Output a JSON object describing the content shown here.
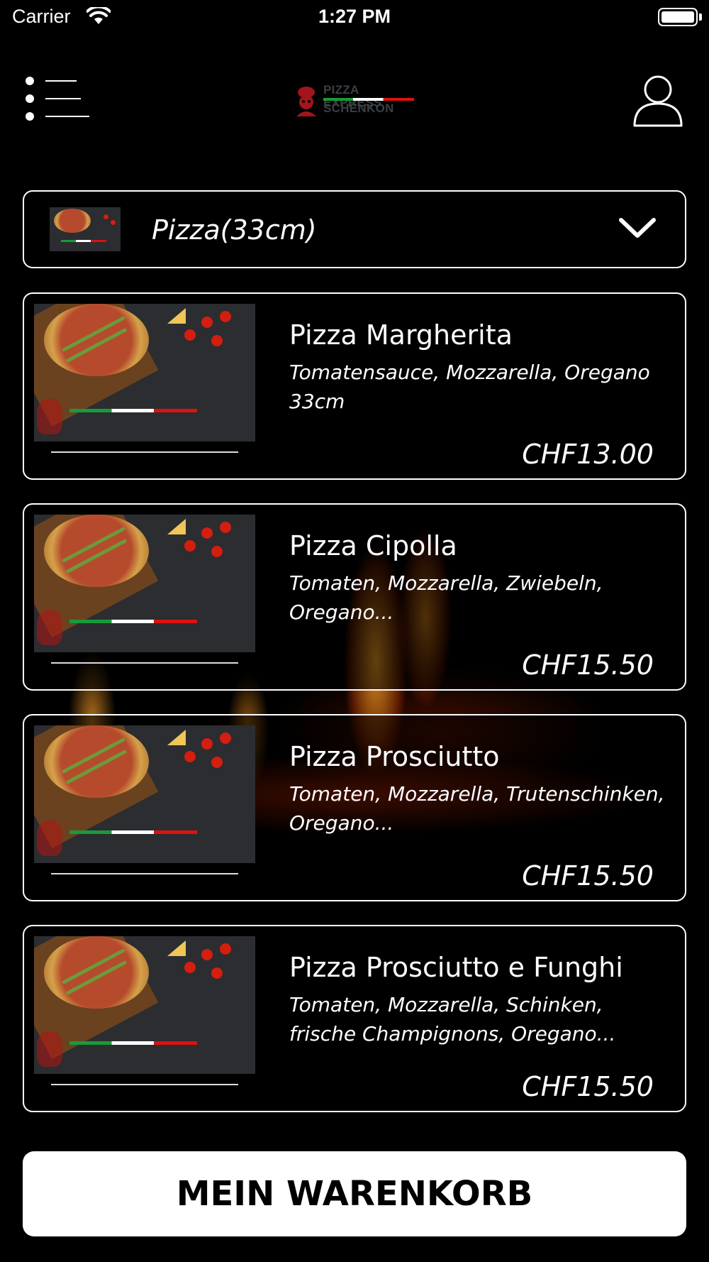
{
  "status_bar": {
    "carrier": "Carrier",
    "time": "1:27 PM"
  },
  "header": {
    "logo_line1": "PIZZA EXPRESS",
    "logo_line2": "SCHENKON"
  },
  "category": {
    "selected": "Pizza(33cm)"
  },
  "products": [
    {
      "name": "Pizza Margherita",
      "description": "Tomatensauce, Mozzarella, Oregano 33cm",
      "price": "CHF13.00"
    },
    {
      "name": "Pizza Cipolla",
      "description": "Tomaten, Mozzarella, Zwiebeln, Oregano...",
      "price": "CHF15.50"
    },
    {
      "name": "Pizza Prosciutto",
      "description": "Tomaten, Mozzarella, Trutenschinken, Oregano...",
      "price": "CHF15.50"
    },
    {
      "name": "Pizza Prosciutto e Funghi",
      "description": "Tomaten, Mozzarella, Schinken, frische Champignons, Oregano...",
      "price": "CHF15.50"
    }
  ],
  "cart": {
    "label": "MEIN WARENKORB"
  },
  "icons": {
    "menu": "menu-list-icon",
    "user": "user-icon",
    "chevron": "chevron-down-icon",
    "wifi": "wifi-icon",
    "battery": "battery-icon"
  },
  "colors": {
    "background": "#000000",
    "text": "#ffffff",
    "button_bg": "#ffffff",
    "button_text": "#000000"
  }
}
